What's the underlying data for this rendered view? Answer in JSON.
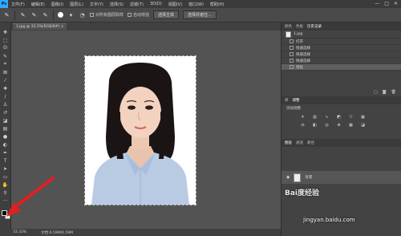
{
  "menubar": {
    "logo": "Ps",
    "items": [
      "文件(F)",
      "编辑(E)",
      "图像(I)",
      "图层(L)",
      "文字(Y)",
      "选择(S)",
      "滤镜(T)",
      "3D(D)",
      "视图(V)",
      "窗口(W)",
      "帮助(H)"
    ],
    "controls": [
      "—",
      "□",
      "✕"
    ]
  },
  "options": {
    "checkbox1": "对所有图层取样",
    "checkbox2": "自动增强",
    "button1": "选择主体",
    "button2": "选择并遮住..."
  },
  "document": {
    "tab_label": "1.jpg @ 33.3%(RGB/8#) ×"
  },
  "status": {
    "zoom": "33.33%",
    "doc_info": "文档:6.59M/6.59M"
  },
  "panels": {
    "top_tabs": [
      "颜色",
      "色板",
      "历史记录"
    ],
    "history_source": "1.jpg",
    "history_items": [
      "打开",
      "快速选择",
      "快速选择",
      "快速选择",
      "羽化"
    ],
    "history_active_index": 4,
    "adj_tabs": [
      "库",
      "调整"
    ],
    "adj_title": "添加调整",
    "layer_tabs": [
      "图层",
      "通道",
      "路径"
    ],
    "layer_name": "背景"
  },
  "watermark": {
    "brand": "Bai度经验",
    "url": "jingyan.baidu.com"
  },
  "colors": {
    "accent": "#31a8ff",
    "arrow": "#e02020",
    "foreground_swatch": "#000000",
    "background_swatch": "#ffffff"
  }
}
